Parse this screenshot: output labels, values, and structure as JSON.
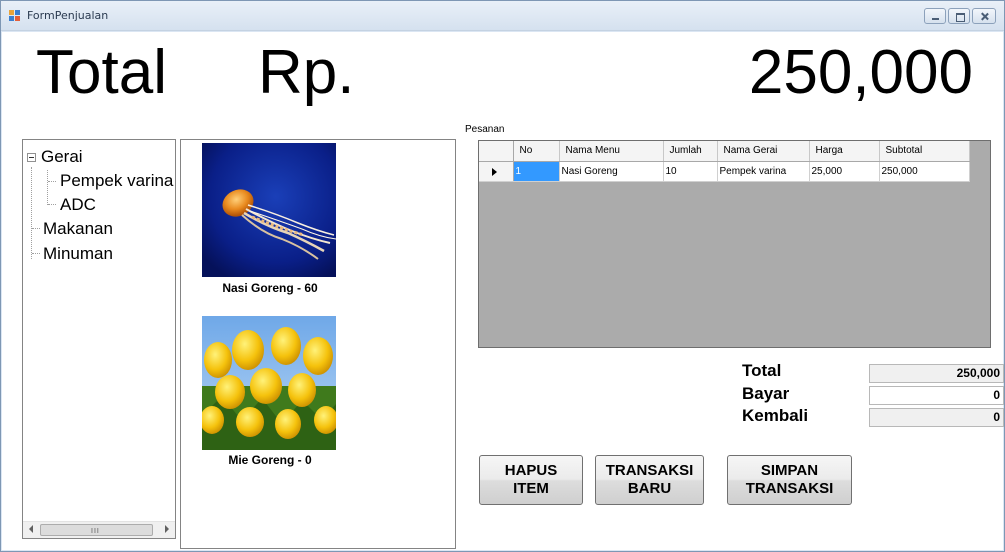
{
  "window": {
    "title": "FormPenjualan",
    "app_icon": "form-icon",
    "controls": [
      "minimize-icon",
      "maximize-icon",
      "close-icon"
    ]
  },
  "header": {
    "total_label": "Total",
    "currency": "Rp.",
    "total_amount": "250,000"
  },
  "tree": {
    "root": "Gerai",
    "children": [
      "Pempek varina",
      "ADC"
    ],
    "siblings": [
      "Makanan",
      "Minuman"
    ],
    "scroll_grip": "III"
  },
  "menu_items": [
    {
      "caption": "Nasi Goreng - 60",
      "image": "jellyfish-photo"
    },
    {
      "caption": "Mie Goreng - 0",
      "image": "yellow-tulips-photo"
    }
  ],
  "pesanan": {
    "group_label": "Pesanan",
    "columns": [
      "No",
      "Nama Menu",
      "Jumlah",
      "Nama Gerai",
      "Harga",
      "Subtotal"
    ],
    "rows": [
      [
        "1",
        "Nasi Goreng",
        "10",
        "Pempek varina",
        "25,000",
        "250,000"
      ]
    ]
  },
  "summary": {
    "total_label": "Total",
    "total_value": "250,000",
    "bayar_label": "Bayar",
    "bayar_value": "0",
    "kembali_label": "Kembali",
    "kembali_value": "0"
  },
  "buttons": {
    "hapus": [
      "HAPUS",
      "ITEM"
    ],
    "transaksi_baru": [
      "TRANSAKSI",
      "BARU"
    ],
    "simpan": [
      "SIMPAN",
      "TRANSAKSI"
    ]
  },
  "colors": {
    "selection": "#3399ff",
    "grid_background": "#ababab",
    "titlebar": "#dbe6f3"
  }
}
